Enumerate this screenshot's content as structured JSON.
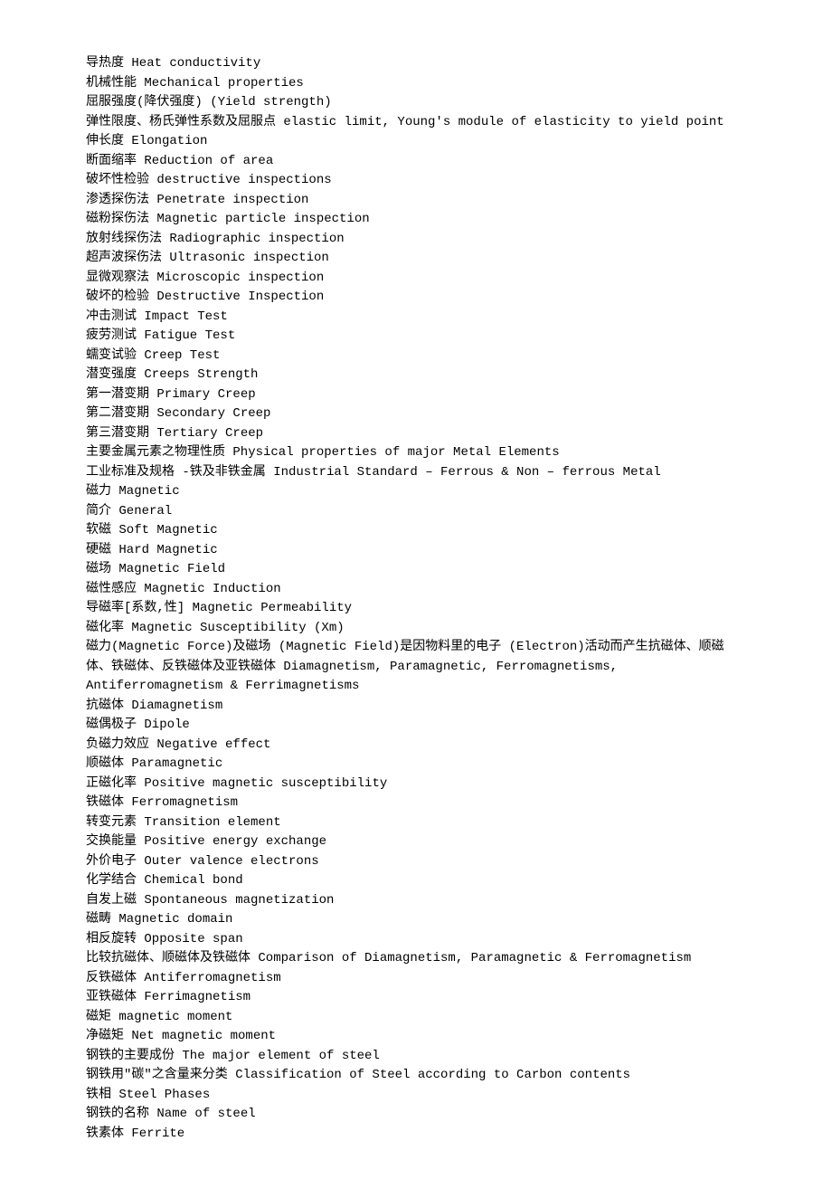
{
  "lines": [
    "导热度 Heat conductivity",
    "机械性能 Mechanical properties",
    "屈服强度(降伏强度) (Yield strength)",
    "弹性限度、杨氏弹性系数及屈服点 elastic limit, Young's module of elasticity to yield point",
    "伸长度 Elongation",
    "断面缩率 Reduction of area",
    "破坏性检验 destructive inspections",
    "渗透探伤法 Penetrate inspection",
    "磁粉探伤法 Magnetic particle inspection",
    "放射线探伤法 Radiographic inspection",
    "超声波探伤法 Ultrasonic inspection",
    "显微观察法 Microscopic inspection",
    "破坏的检验 Destructive Inspection",
    "冲击测试 Impact Test",
    "疲劳测试 Fatigue Test",
    "蠕变试验 Creep Test",
    "潜变强度 Creeps Strength",
    "第一潜变期 Primary Creep",
    "第二潜变期 Secondary Creep",
    "第三潜变期 Tertiary Creep",
    "主要金属元素之物理性质 Physical properties of major Metal Elements",
    "工业标准及规格 -铁及非铁金属 Industrial Standard – Ferrous & Non – ferrous Metal",
    "磁力 Magnetic",
    "简介 General",
    "软磁 Soft Magnetic",
    "硬磁 Hard Magnetic",
    "磁场 Magnetic Field",
    "磁性感应 Magnetic Induction",
    "导磁率[系数,性] Magnetic Permeability",
    "磁化率 Magnetic Susceptibility (Xm)",
    "磁力(Magnetic Force)及磁场 (Magnetic Field)是因物料里的电子 (Electron)活动而产生抗磁体、顺磁体、铁磁体、反铁磁体及亚铁磁体 Diamagnetism, Paramagnetic, Ferromagnetisms, Antiferromagnetism & Ferrimagnetisms",
    "抗磁体 Diamagnetism",
    "磁偶极子 Dipole",
    "负磁力效应 Negative effect",
    "顺磁体 Paramagnetic",
    "正磁化率 Positive magnetic susceptibility",
    "铁磁体 Ferromagnetism",
    "转变元素 Transition element",
    "交换能量 Positive energy exchange",
    "外价电子 Outer valence electrons",
    "化学结合 Chemical bond",
    "自发上磁 Spontaneous magnetization",
    "磁畴 Magnetic domain",
    "相反旋转 Opposite span",
    "比较抗磁体、顺磁体及铁磁体 Comparison of Diamagnetism, Paramagnetic & Ferromagnetism",
    "反铁磁体 Antiferromagnetism",
    "亚铁磁体 Ferrimagnetism",
    "磁矩 magnetic moment",
    "净磁矩 Net magnetic moment",
    "钢铁的主要成份 The major element of steel",
    "钢铁用\"碳\"之含量来分类 Classification of Steel according to Carbon contents",
    "铁相 Steel Phases",
    "钢铁的名称 Name of steel",
    "铁素体 Ferrite"
  ]
}
